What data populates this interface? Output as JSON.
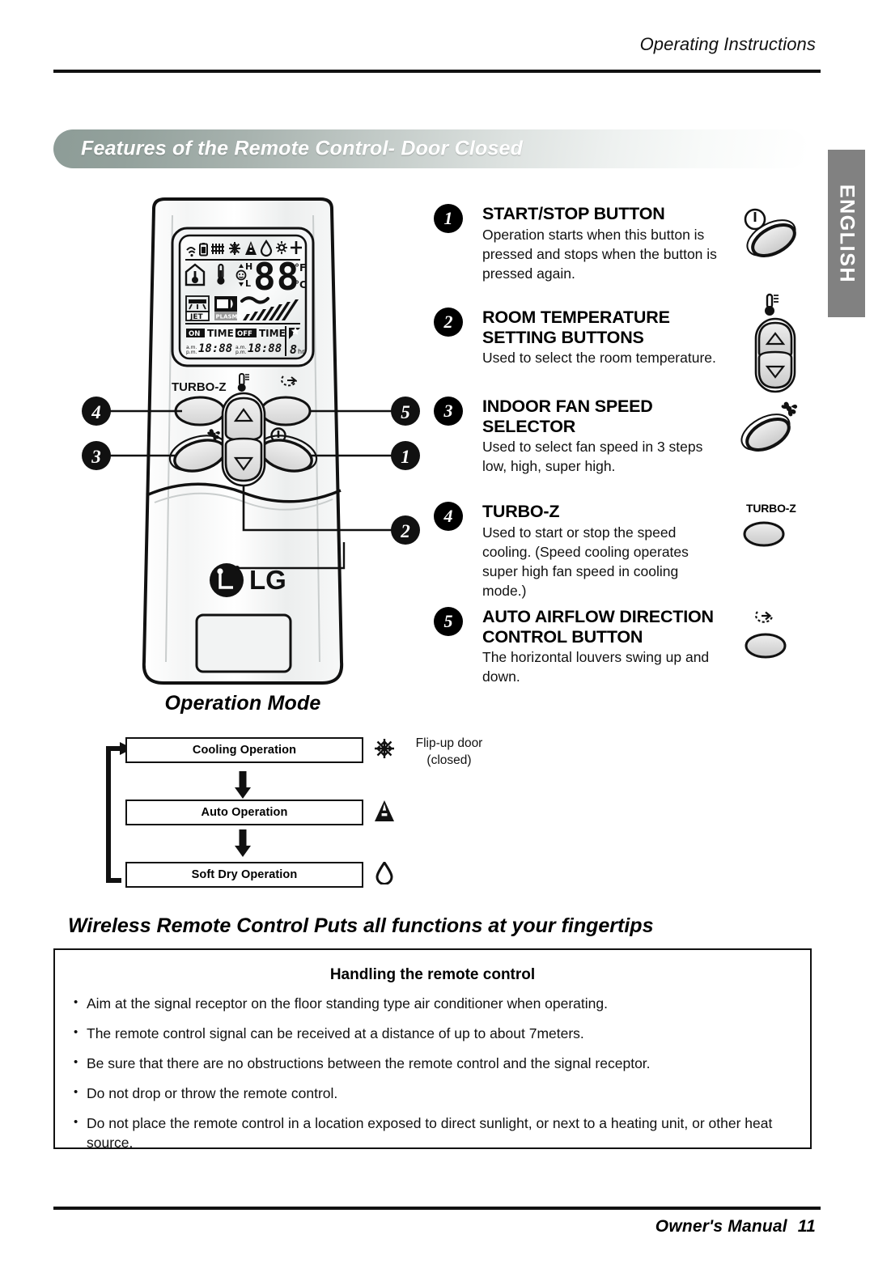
{
  "header": {
    "eyebrow": "Operating Instructions"
  },
  "lang_tab": {
    "label": "ENGLISH"
  },
  "banner": {
    "title": "Features of the Remote Control- Door Closed"
  },
  "remote": {
    "turbo_label": "TURBO-Z",
    "brand": "LG",
    "flip_label_line1": "Flip-up door",
    "flip_label_line2": "(closed)",
    "callouts": [
      "1",
      "2",
      "3",
      "4",
      "5"
    ],
    "lcd": {
      "top_icons": [
        "signal-icon",
        "battery-icon",
        "filter-icon",
        "snowflake-icon",
        "auto-icon",
        "drop-icon",
        "sun-icon",
        "plus-icon"
      ],
      "room_icon": "house-thermometer-icon",
      "temp_icon": "thermometer-icon",
      "fan_high": "H",
      "fan_low": "L",
      "digits": "88",
      "unit_f": "°F",
      "unit_c": "°C",
      "jet_label": "JET",
      "plasma_label": "PLASMA",
      "on_label": "ON",
      "off_label": "OFF",
      "time_label": "TIME",
      "am_label": "a.m.",
      "pm_label": "p.m.",
      "on_time": "18:88",
      "off_time": "18:88",
      "sleep_value": "8",
      "sleep_unit": "hr."
    }
  },
  "features": [
    {
      "num": "1",
      "title": "START/STOP BUTTON",
      "desc": "Operation starts when this button is pressed and stops when the button is pressed again.",
      "art": "power-oval-button"
    },
    {
      "num": "2",
      "title": "ROOM TEMPERATURE SETTING BUTTONS",
      "desc": "Used to select the room temperature.",
      "art": "temp-up-down-buttons"
    },
    {
      "num": "3",
      "title": "INDOOR FAN SPEED SELECTOR",
      "desc": "Used to select fan speed in 3 steps low, high, super high.",
      "art": "fan-oval-button"
    },
    {
      "num": "4",
      "title": "TURBO-Z",
      "desc": "Used to start or stop the speed cooling. (Speed cooling operates super high fan speed in cooling mode.)",
      "art": "turbo-z-button",
      "art_label": "TURBO-Z"
    },
    {
      "num": "5",
      "title": "AUTO AIRFLOW DIRECTION CONTROL BUTTON",
      "desc": "The horizontal louvers swing up and down.",
      "art": "airflow-swing-button"
    }
  ],
  "operation_mode": {
    "title": "Operation Mode",
    "steps": [
      {
        "label": "Cooling Operation",
        "icon": "snowflake-icon",
        "glyph": "✳"
      },
      {
        "label": "Auto Operation",
        "icon": "auto-triangle-icon",
        "glyph": "▲"
      },
      {
        "label": "Soft Dry Operation",
        "icon": "water-drop-icon",
        "glyph": "◇"
      }
    ]
  },
  "wireless": {
    "title": "Wireless Remote Control Puts all functions at your fingertips",
    "note_title": "Handling the remote control",
    "notes": [
      "Aim at the signal receptor on the floor standing type air conditioner when operating.",
      "The remote control signal can be received at a distance of up to about 7meters.",
      "Be sure that there are no obstructions between the remote control and the signal receptor.",
      "Do not drop or throw the remote control.",
      "Do not place the remote control in a location exposed to direct sunlight, or next to a heating unit, or other heat source."
    ]
  },
  "footer": {
    "label": "Owner's Manual",
    "page": "11"
  }
}
